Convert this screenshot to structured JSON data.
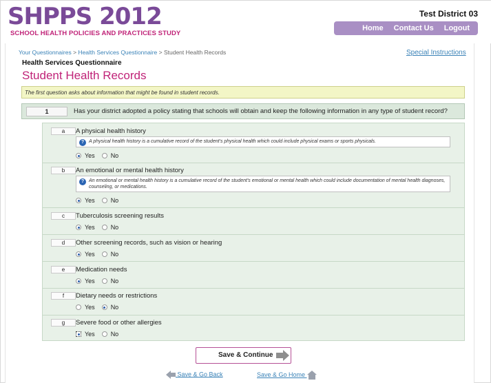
{
  "header": {
    "logo_text": "SHPPS 2012",
    "logo_subtitle": "SCHOOL HEALTH POLICIES AND PRACTICES STUDY",
    "district": "Test District 03",
    "nav": [
      "Home",
      "Contact Us",
      "Logout"
    ]
  },
  "breadcrumbs": {
    "items": [
      "Your Questionnaires",
      "Health Services Questionnaire",
      "Student Health Records"
    ],
    "separator": ">"
  },
  "special_link": "Special Instructions",
  "questionnaire_name": "Health Services Questionnaire",
  "page_title": "Student Health Records",
  "intro_note": "The first question asks about information that might be found in student records.",
  "question": {
    "number": "1",
    "text": "Has your district adopted a policy stating that schools will obtain and keep the following information in any type of student record?"
  },
  "items": [
    {
      "letter": "a",
      "label": "A physical health history",
      "hint": "A physical health history is a cumulative record of the student's physical health which could include physical exams or sports physicals.",
      "selected": "Yes"
    },
    {
      "letter": "b",
      "label": "An emotional or mental health history",
      "hint": "An emotional or mental health history is a cumulative record of the student's emotional or mental health which could include documentation of mental health diagnoses, counseling, or medications.",
      "selected": "Yes"
    },
    {
      "letter": "c",
      "label": "Tuberculosis screening results",
      "hint": "",
      "selected": "Yes"
    },
    {
      "letter": "d",
      "label": "Other screening records, such as vision or hearing",
      "hint": "",
      "selected": "Yes"
    },
    {
      "letter": "e",
      "label": "Medication needs",
      "hint": "",
      "selected": "Yes"
    },
    {
      "letter": "f",
      "label": "Dietary needs or restrictions",
      "hint": "",
      "selected": "No"
    },
    {
      "letter": "g",
      "label": "Severe food or other allergies",
      "hint": "",
      "selected": "Yes"
    }
  ],
  "options": {
    "yes": "Yes",
    "no": "No"
  },
  "buttons": {
    "save_continue": "Save & Continue",
    "save_back": "Save & Go Back",
    "save_home": "Save & Go Home"
  },
  "colors": {
    "accent_purple": "#7a4a98",
    "accent_magenta": "#c02378",
    "nav_bg": "#a98fc4",
    "link_blue": "#3a82b7"
  }
}
